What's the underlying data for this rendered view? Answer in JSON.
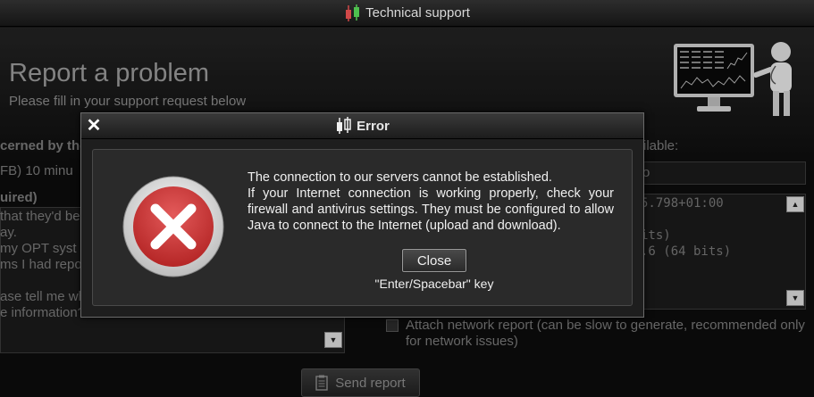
{
  "window": {
    "title": "Technical support"
  },
  "page": {
    "heading": "Report a problem",
    "subheading": "Please fill in your support request below"
  },
  "background": {
    "concerned_label": "cerned by the",
    "timeframe_text": "FB)   10 minu",
    "required_label": "uired)",
    "text_lines": [
      "that they'd be",
      "ay.",
      "  my OPT syst",
      "ms I had repor",
      "",
      "ase tell me wh",
      "e information?"
    ],
    "available_label": "ilable:",
    "field_value": "o",
    "sysinfo_lines": [
      "5.798+01:00",
      "",
      "its)",
      ".6 (64 bits)"
    ],
    "attach_label_line1": "Attach network report (can be slow to generate, recommended only",
    "attach_label_line2": "for network issues)",
    "send_button": "Send report"
  },
  "dialog": {
    "title": "Error",
    "close_symbol": "✕",
    "message_lines": [
      "The connection to our servers cannot be established.",
      "If your Internet connection is working properly, check your firewall and antivirus settings. They must be configured to allow Java to connect to the Internet (upload and download)."
    ],
    "close_button": "Close",
    "hint": "\"Enter/Spacebar\" key"
  },
  "colors": {
    "error_red": "#d23a3a",
    "candle_red": "#d04848",
    "candle_green": "#4ec04e"
  }
}
